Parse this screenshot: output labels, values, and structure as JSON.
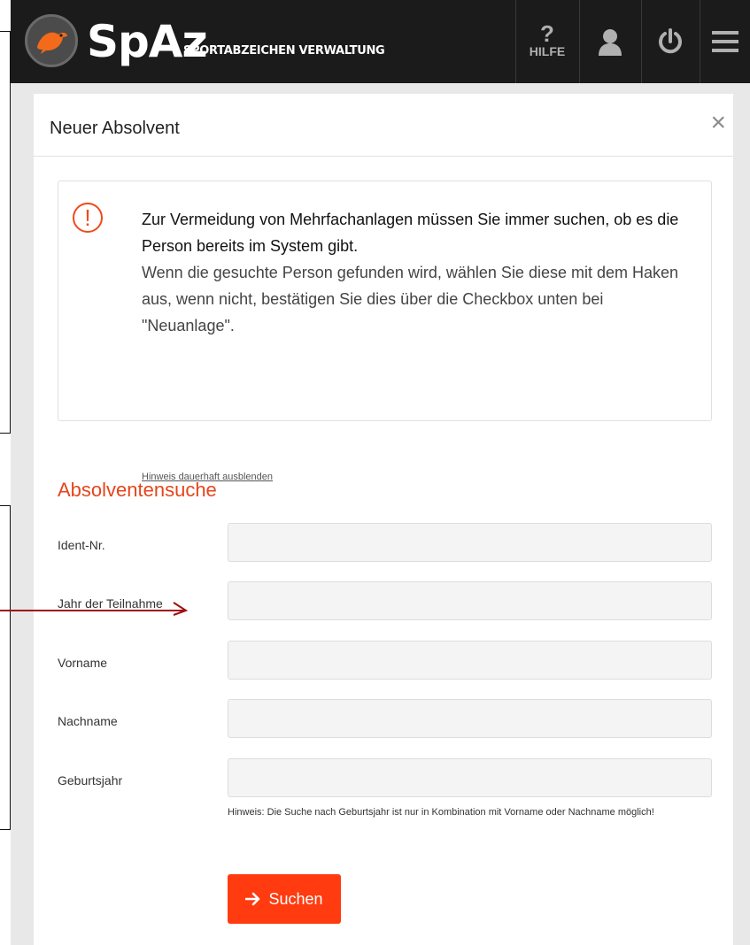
{
  "header": {
    "brand": "SpAz",
    "brand_sub": "SPORTABZEICHEN VERWALTUNG",
    "help_label": "HILFE",
    "icons": [
      "bird-logo-icon",
      "help-icon",
      "user-icon",
      "power-icon",
      "menu-icon"
    ]
  },
  "dialog": {
    "title": "Neuer Absolvent",
    "close": "×"
  },
  "notice": {
    "icon": "!",
    "strong": "Zur Vermeidung von Mehrfachanlagen müssen Sie immer suchen, ob es die Person bereits im System gibt.",
    "normal": "Wenn die gesuchte Person gefunden wird, wählen Sie diese mit dem Haken aus, wenn nicht, bestätigen Sie dies über die Checkbox unten bei \"Neuanlage\".",
    "hide_link": "Hinweis dauerhaft ausblenden"
  },
  "search": {
    "title": "Absolventensuche",
    "fields": [
      {
        "label": "Ident-Nr.",
        "value": ""
      },
      {
        "label": "Jahr der Teilnahme",
        "value": ""
      },
      {
        "label": "Vorname",
        "value": ""
      },
      {
        "label": "Nachname",
        "value": ""
      },
      {
        "label": "Geburtsjahr",
        "value": ""
      }
    ],
    "hint": "Hinweis: Die Suche nach Geburtsjahr ist nur in Kombination mit Vorname oder Nachname möglich!",
    "button_label": "Suchen"
  },
  "colors": {
    "accent": "#ff3b0f",
    "section_title": "#e5451c",
    "header_bg": "#1b1b1b",
    "annotation_arrow": "#a01010"
  }
}
